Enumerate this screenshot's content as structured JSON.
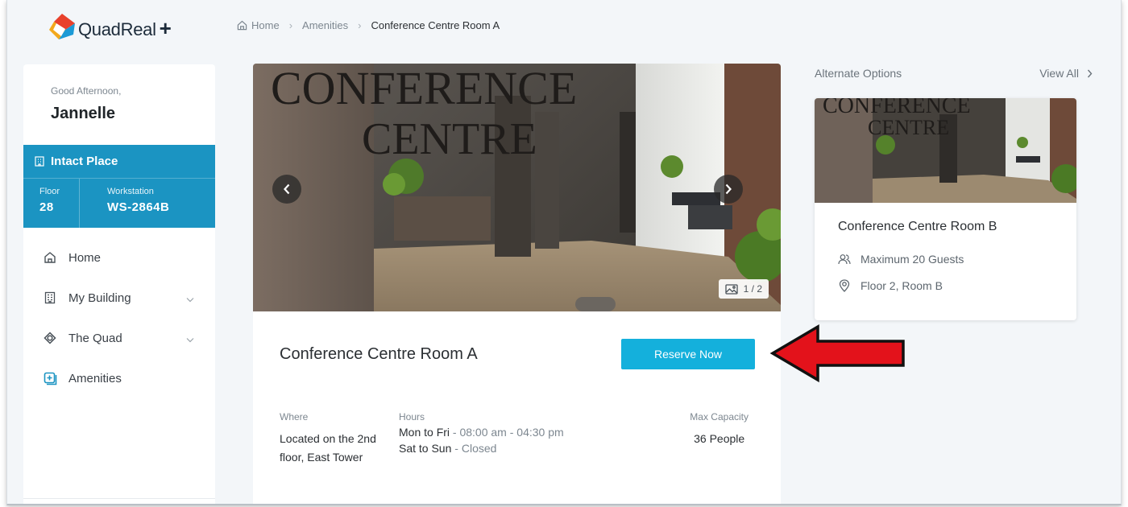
{
  "brand": {
    "name": "QuadReal",
    "plus": "+"
  },
  "breadcrumb": {
    "home": "Home",
    "section": "Amenities",
    "current": "Conference Centre Room A"
  },
  "sidebar": {
    "greeting": "Good Afternoon,",
    "user_name": "Jannelle",
    "place": {
      "name": "Intact Place",
      "floor_label": "Floor",
      "floor_value": "28",
      "workstation_label": "Workstation",
      "workstation_value": "WS-2864B"
    },
    "nav": [
      {
        "label": "Home",
        "icon": "home-icon"
      },
      {
        "label": "My Building",
        "icon": "building-icon"
      },
      {
        "label": "The Quad",
        "icon": "quad-icon"
      },
      {
        "label": "Amenities",
        "icon": "amenities-icon"
      }
    ]
  },
  "hero": {
    "sign_line1": "CONFERENCE",
    "sign_line2": "CENTRE",
    "counter": "1 / 2"
  },
  "room": {
    "title": "Conference Centre Room A",
    "reserve_label": "Reserve Now",
    "where_label": "Where",
    "where_value": "Located on the 2nd floor, East Tower",
    "hours_label": "Hours",
    "hours_weekday_days": "Mon to Fri",
    "hours_weekday_time": "08:00 am - 04:30 pm",
    "hours_weekend_days": "Sat to Sun",
    "hours_weekend_time": "Closed",
    "capacity_label": "Max Capacity",
    "capacity_value": "36 People"
  },
  "alternate": {
    "header": "Alternate Options",
    "view_all": "View All",
    "card": {
      "sign_line1": "CONFERENCE",
      "sign_line2": "CENTRE",
      "title": "Conference Centre Room B",
      "guests": "Maximum 20 Guests",
      "location": "Floor 2, Room B"
    }
  },
  "colors": {
    "accent": "#1b94c2",
    "button": "#14b0dc",
    "annotation_arrow": "#e3121b"
  }
}
